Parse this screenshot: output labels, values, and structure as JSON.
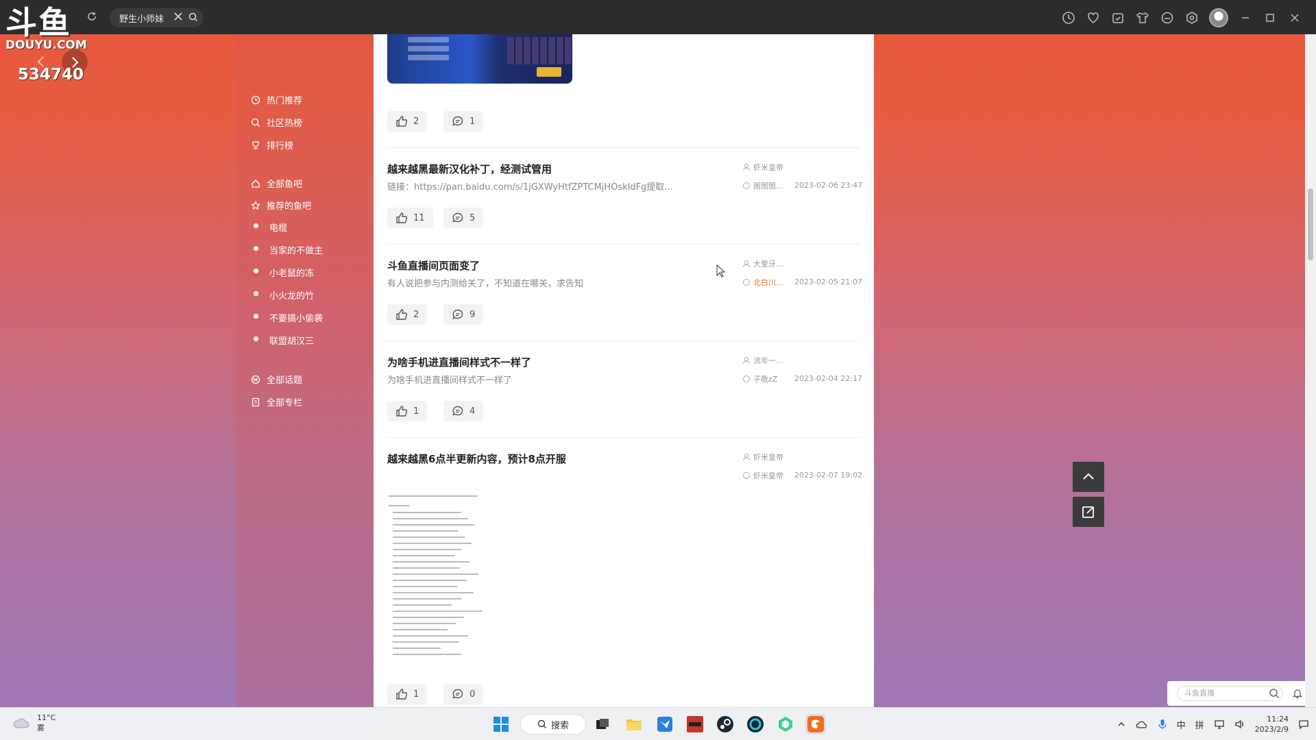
{
  "titlebar": {
    "tab_label": "野生小师妹"
  },
  "logo": {
    "main": "斗鱼",
    "sub": "DOUYU.COM",
    "room_number": "534740"
  },
  "sidebar": {
    "top_items": [
      "热门推荐",
      "社区热榜",
      "排行榜"
    ],
    "fishbar_all": "全部鱼吧",
    "fishbar_recommended": "推荐的鱼吧",
    "fishbars": [
      "电棍",
      "当家的不做主",
      "小老鼠的冻",
      "小火龙的竹",
      "不要搞小偷袭",
      "联盟胡汉三"
    ],
    "topics_all": "全部话题",
    "columns_all": "全部专栏"
  },
  "posts": [
    {
      "likes": "2",
      "comments": "1"
    },
    {
      "title": "越来越黑最新汉化补丁，经测试管用",
      "desc": "链接：https://pan.baidu.com/s/1jGXWyHtfZPTCMjHOskldFg提取...",
      "author": "虾米皇帝",
      "last_reply": "图图图...",
      "time": "2023-02-06 23:47",
      "likes": "11",
      "comments": "5"
    },
    {
      "title": "斗鱼直播间页面变了",
      "desc": "有人说把参与内测给关了，不知道在哪关，求告知",
      "author": "大爱牙...",
      "last_reply": "北白川...",
      "time": "2023-02-05 21:07",
      "likes": "2",
      "comments": "9"
    },
    {
      "title": "为啥手机进直播间样式不一样了",
      "desc": "为啥手机进直播间样式不一样了",
      "author": "流年一...",
      "last_reply": "子敬zZ",
      "time": "2023-02-04 22:17",
      "likes": "1",
      "comments": "4"
    },
    {
      "title": "越来越黑6点半更新内容，预计8点开服",
      "author": "虾米皇帝",
      "last_reply": "虾米皇帝",
      "time": "2023-02-07 19:02",
      "likes": "1",
      "comments": "0"
    }
  ],
  "search": {
    "placeholder": "斗鱼直播"
  },
  "taskbar": {
    "temp": "11°C",
    "weather": "雾",
    "search_label": "搜索",
    "ime1": "中",
    "ime2": "拼",
    "time": "11:24",
    "date": "2023/2/9"
  },
  "colors": {
    "accent_orange": "#e8711c",
    "bg_top": "#e6553a",
    "bg_bottom": "#9f78b8"
  }
}
